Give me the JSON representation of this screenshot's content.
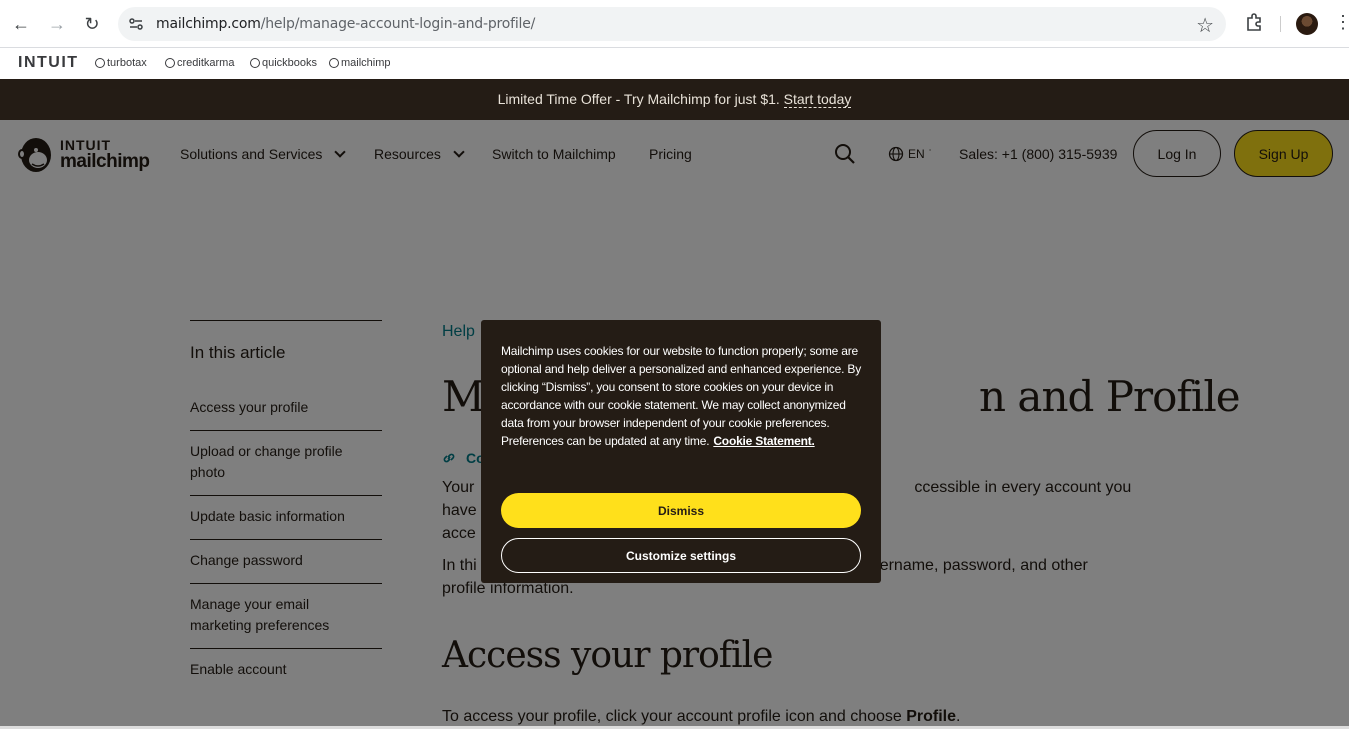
{
  "browser": {
    "url_host": "mailchimp.com",
    "url_path": "/help/manage-account-login-and-profile/"
  },
  "intuit_bar": {
    "logo": "INTUIT",
    "brands": [
      "turbotax",
      "creditkarma",
      "quickbooks",
      "mailchimp"
    ]
  },
  "promo": {
    "text": "Limited Time Offer - Try Mailchimp for just $1.",
    "link": "Start today"
  },
  "header": {
    "logo_top": "INTUIT",
    "logo_bottom": "mailchimp",
    "nav": [
      "Solutions and Services",
      "Resources",
      "Switch to Mailchimp",
      "Pricing"
    ],
    "lang": "EN",
    "sales": "Sales: +1 (800) 315-5939",
    "login": "Log In",
    "signup": "Sign Up"
  },
  "toc": {
    "title": "In this article",
    "items": [
      "Access your profile",
      "Upload or change profile photo",
      "Update basic information",
      "Change password",
      "Manage your email marketing preferences",
      "Enable account"
    ]
  },
  "article": {
    "breadcrumb": "Help",
    "title_visible_left": "M",
    "title_visible_right": "n and Profile",
    "copy_link": "Co",
    "para1_left": "Your",
    "para1_right": "ccessible in every account you have",
    "para1_line2": "acce",
    "para2_left": "In thi",
    "para2_right": "sername, password, and other",
    "para2_line2": "profile information.",
    "h2": "Access your profile",
    "last_line_prefix": "To access your profile, click your account profile icon and choose ",
    "last_line_bold": "Profile",
    "last_line_suffix": "."
  },
  "cookie": {
    "text": "Mailchimp uses cookies for our website to function properly; some are optional and help deliver a personalized and enhanced experience. By clicking “Dismiss”, you consent to store cookies on your device in accordance with our cookie statement. We may collect anonymized data from your browser independent of your cookie preferences. Preferences can be updated at any time.",
    "link": "Cookie Statement.",
    "dismiss": "Dismiss",
    "customize": "Customize settings"
  },
  "colors": {
    "brand_yellow": "#ffe01b",
    "dark": "#241c15",
    "link_teal": "#007c89"
  }
}
